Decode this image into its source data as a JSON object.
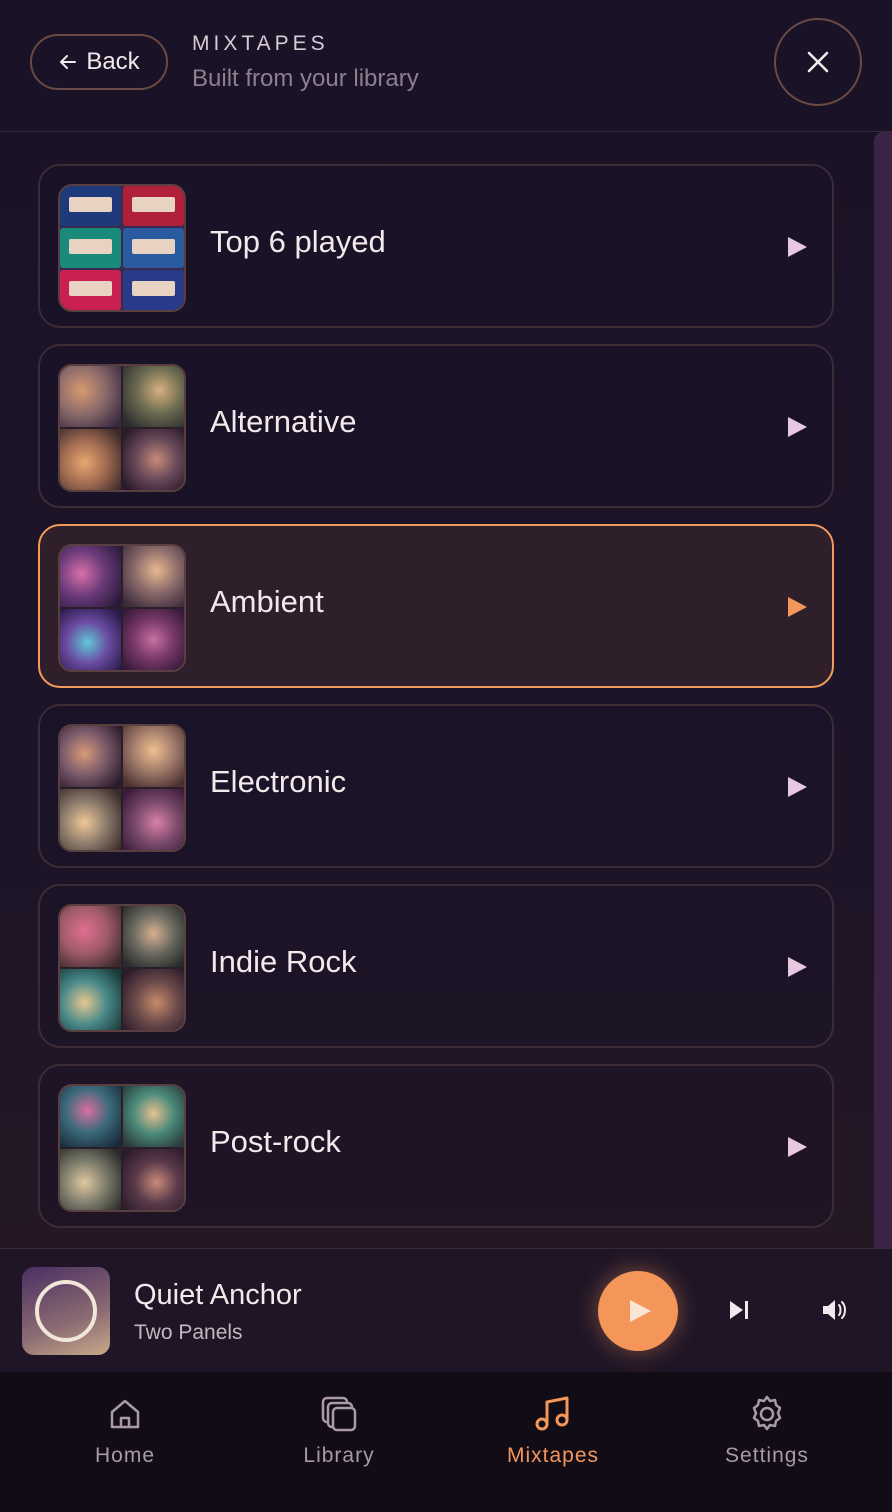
{
  "header": {
    "back_label": "Back",
    "eyebrow": "MIXTAPES",
    "subtitle": "Built from your library"
  },
  "mixtapes": [
    {
      "title": "Top 6 played",
      "active": false
    },
    {
      "title": "Alternative",
      "active": false
    },
    {
      "title": "Ambient",
      "active": true
    },
    {
      "title": "Electronic",
      "active": false
    },
    {
      "title": "Indie Rock",
      "active": false
    },
    {
      "title": "Post-rock",
      "active": false
    }
  ],
  "now_playing": {
    "title": "Quiet Anchor",
    "artist": "Two Panels"
  },
  "nav": {
    "items": [
      {
        "label": "Home",
        "icon": "home-icon"
      },
      {
        "label": "Library",
        "icon": "library-icon"
      },
      {
        "label": "Mixtapes",
        "icon": "music-note-icon",
        "active": true
      },
      {
        "label": "Settings",
        "icon": "gear-icon"
      }
    ]
  },
  "colors": {
    "accent": "#f4955a",
    "background": "#1a1226",
    "card_border": "#3d2b36",
    "play_triangle": "#e8c8e0"
  }
}
